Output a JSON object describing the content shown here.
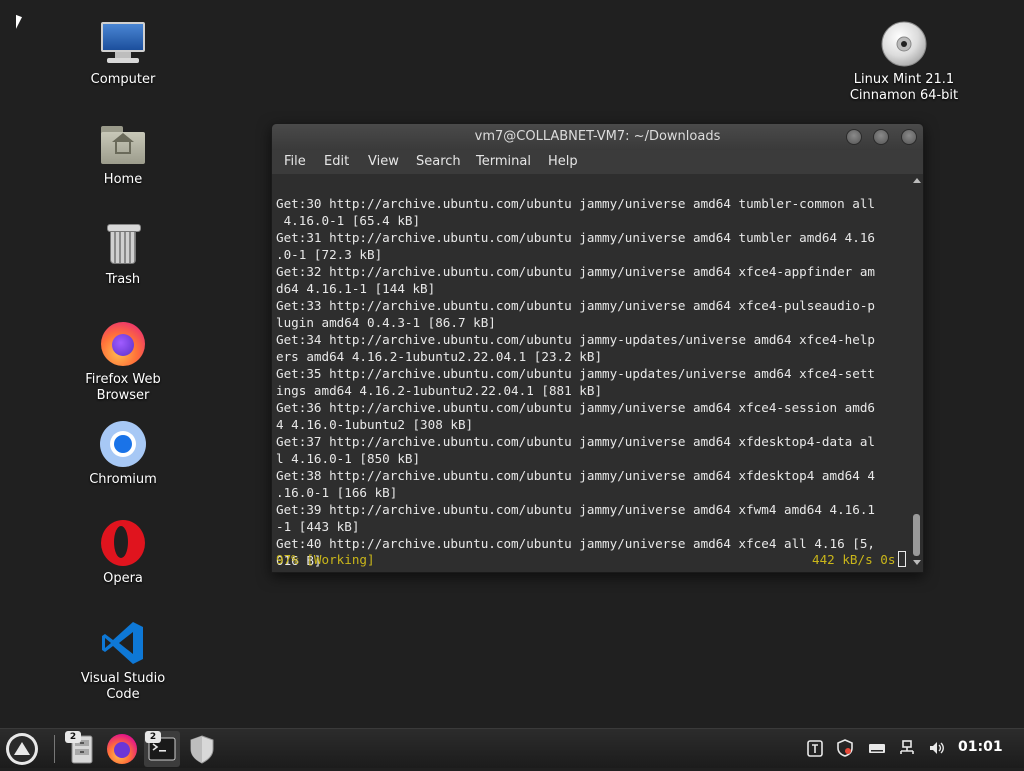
{
  "desktop": {
    "icons": [
      {
        "label": "Computer"
      },
      {
        "label": "Home"
      },
      {
        "label": "Trash"
      },
      {
        "label_line1": "Firefox Web",
        "label_line2": "Browser"
      },
      {
        "label": "Chromium"
      },
      {
        "label": "Opera"
      },
      {
        "label_line1": "Visual Studio",
        "label_line2": "Code"
      }
    ],
    "disc": {
      "label_line1": "Linux Mint 21.1",
      "label_line2": "Cinnamon 64-bit"
    }
  },
  "terminal": {
    "title": "vm7@COLLABNET-VM7: ~/Downloads",
    "menu": [
      "File",
      "Edit",
      "View",
      "Search",
      "Terminal",
      "Help"
    ],
    "lines": [
      "Get:30 http://archive.ubuntu.com/ubuntu jammy/universe amd64 tumbler-common all",
      " 4.16.0-1 [65.4 kB]",
      "Get:31 http://archive.ubuntu.com/ubuntu jammy/universe amd64 tumbler amd64 4.16",
      ".0-1 [72.3 kB]",
      "Get:32 http://archive.ubuntu.com/ubuntu jammy/universe amd64 xfce4-appfinder am",
      "d64 4.16.1-1 [144 kB]",
      "Get:33 http://archive.ubuntu.com/ubuntu jammy/universe amd64 xfce4-pulseaudio-p",
      "lugin amd64 0.4.3-1 [86.7 kB]",
      "Get:34 http://archive.ubuntu.com/ubuntu jammy-updates/universe amd64 xfce4-help",
      "ers amd64 4.16.2-1ubuntu2.22.04.1 [23.2 kB]",
      "Get:35 http://archive.ubuntu.com/ubuntu jammy-updates/universe amd64 xfce4-sett",
      "ings amd64 4.16.2-1ubuntu2.22.04.1 [881 kB]",
      "Get:36 http://archive.ubuntu.com/ubuntu jammy/universe amd64 xfce4-session amd6",
      "4 4.16.0-1ubuntu2 [308 kB]",
      "Get:37 http://archive.ubuntu.com/ubuntu jammy/universe amd64 xfdesktop4-data al",
      "l 4.16.0-1 [850 kB]",
      "Get:38 http://archive.ubuntu.com/ubuntu jammy/universe amd64 xfdesktop4 amd64 4",
      ".16.0-1 [166 kB]",
      "Get:39 http://archive.ubuntu.com/ubuntu jammy/universe amd64 xfwm4 amd64 4.16.1",
      "-1 [443 kB]",
      "Get:40 http://archive.ubuntu.com/ubuntu jammy/universe amd64 xfce4 all 4.16 [5,",
      "016 B]"
    ],
    "status_left": "97% [Working]",
    "status_right": "442 kB/s 0s"
  },
  "taskbar": {
    "file_manager_badge": "2",
    "terminal_badge": "2",
    "clock": "01:01",
    "colors": {
      "accent": "#c9b61a",
      "terminal_bg": "#2e2e2e"
    }
  }
}
